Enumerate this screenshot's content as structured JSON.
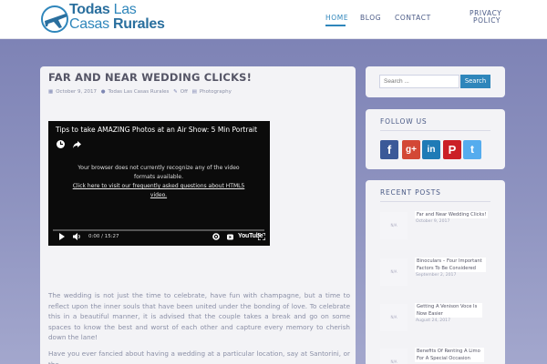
{
  "header": {
    "logo_line1": "Todas",
    "logo_line1_light": "Las",
    "logo_line2": "Casas",
    "logo_line2_b": "Rurales",
    "nav": [
      {
        "label": "HOME",
        "active": true
      },
      {
        "label": "BLOG",
        "active": false
      },
      {
        "label": "CONTACT",
        "active": false
      },
      {
        "label": "PRIVACY",
        "active": false
      },
      {
        "label": "POLICY",
        "active": false
      }
    ]
  },
  "post": {
    "title": "FAR AND NEAR WEDDING CLICKS!",
    "date": "October 9, 2017",
    "author": "Todas Las Casas Rurales",
    "comments": "Off",
    "category": "Photography",
    "video": {
      "title": "Tips to take AMAZING Photos at an Air Show: 5 Min Portrait",
      "message_line1": "Your browser does not currently recognize any of the video",
      "message_line2": "formats available.",
      "link_line1": "Click here to visit our frequently asked questions about HTML5",
      "link_line2": "video.",
      "time": "0:00 / 15:27",
      "brand": "YouTube"
    },
    "paragraph1": "The wedding is not just the time to celebrate, have fun with champagne, but a time to reflect upon the inner souls that have been united under the bonding of love. To celebrate this in a beautiful manner, it is advised that the couple takes a break and go on some spaces to know the best and worst of each other and capture every memory to cherish down the lane!",
    "paragraph2": "Have you ever fancied about having a wedding at a particular location, say at Santorini, or the"
  },
  "sidebar": {
    "search": {
      "placeholder": "Search ...",
      "button": "Search"
    },
    "follow_title": "FOLLOW US",
    "social": [
      {
        "name": "facebook",
        "glyph": "f"
      },
      {
        "name": "google-plus",
        "glyph": "g+"
      },
      {
        "name": "linkedin",
        "glyph": "in"
      },
      {
        "name": "pinterest",
        "glyph": "P"
      },
      {
        "name": "twitter",
        "glyph": "t"
      }
    ],
    "recent_title": "RECENT POSTS",
    "recent_posts": [
      {
        "title": "Far and Near Wedding Clicks!",
        "date": "October 9, 2017",
        "thumb": "N/A"
      },
      {
        "title": "Binoculars – Four Important Factors To Be Considered",
        "date": "September 2, 2017",
        "thumb": "N/A"
      },
      {
        "title": "Getting A Venison Voce Is Now Easier",
        "date": "August 24, 2017",
        "thumb": "N/A"
      },
      {
        "title": "Benefits Of Renting A Limo For A Special Occasion",
        "date": "",
        "thumb": "N/A"
      }
    ]
  },
  "colors": {
    "accent": "#2f86bb",
    "background": "#8e93c0",
    "card": "#f3f3f6"
  }
}
